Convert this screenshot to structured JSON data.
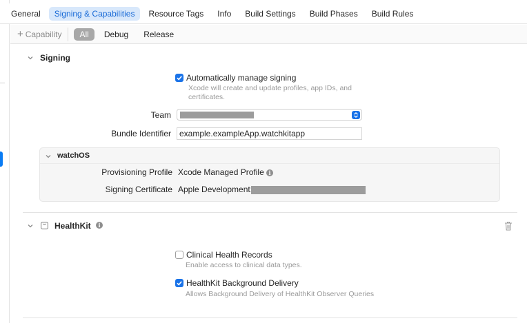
{
  "tabs": [
    {
      "label": "General",
      "active": false
    },
    {
      "label": "Signing & Capabilities",
      "active": true
    },
    {
      "label": "Resource Tags",
      "active": false
    },
    {
      "label": "Info",
      "active": false
    },
    {
      "label": "Build Settings",
      "active": false
    },
    {
      "label": "Build Phases",
      "active": false
    },
    {
      "label": "Build Rules",
      "active": false
    }
  ],
  "filter": {
    "capability_label": "Capability",
    "segments": [
      {
        "label": "All",
        "active": true
      },
      {
        "label": "Debug",
        "active": false
      },
      {
        "label": "Release",
        "active": false
      }
    ]
  },
  "signing": {
    "title": "Signing",
    "auto_manage_label": "Automatically manage signing",
    "auto_manage_checked": true,
    "auto_manage_hint_line1": "Xcode will create and update profiles, app IDs, and",
    "auto_manage_hint_line2": "certificates.",
    "team_label": "Team",
    "bundle_id_label": "Bundle Identifier",
    "bundle_id_value": "example.exampleApp.watchkitapp",
    "watchos": {
      "title": "watchOS",
      "provisioning_label": "Provisioning Profile",
      "provisioning_value": "Xcode Managed Profile",
      "certificate_label": "Signing Certificate",
      "certificate_value": "Apple Development:"
    }
  },
  "healthkit": {
    "title": "HealthKit",
    "clinical_label": "Clinical Health Records",
    "clinical_checked": false,
    "clinical_hint": "Enable access to clinical data types.",
    "background_label": "HealthKit Background Delivery",
    "background_checked": true,
    "background_hint": "Allows Background Delivery of HealthKit Observer Queries"
  },
  "icons": {
    "chevron": "chevron-down-icon",
    "info": "info-icon",
    "trash": "trash-icon",
    "capability": "plus-icon",
    "healthkit": "healthkit-icon",
    "checkmark": "checkmark-icon"
  },
  "colors": {
    "accent": "#1a73e8",
    "tab_active_bg": "#d8e8fb",
    "tab_active_text": "#1769d6",
    "segment_active_bg": "#a8a8a8"
  }
}
